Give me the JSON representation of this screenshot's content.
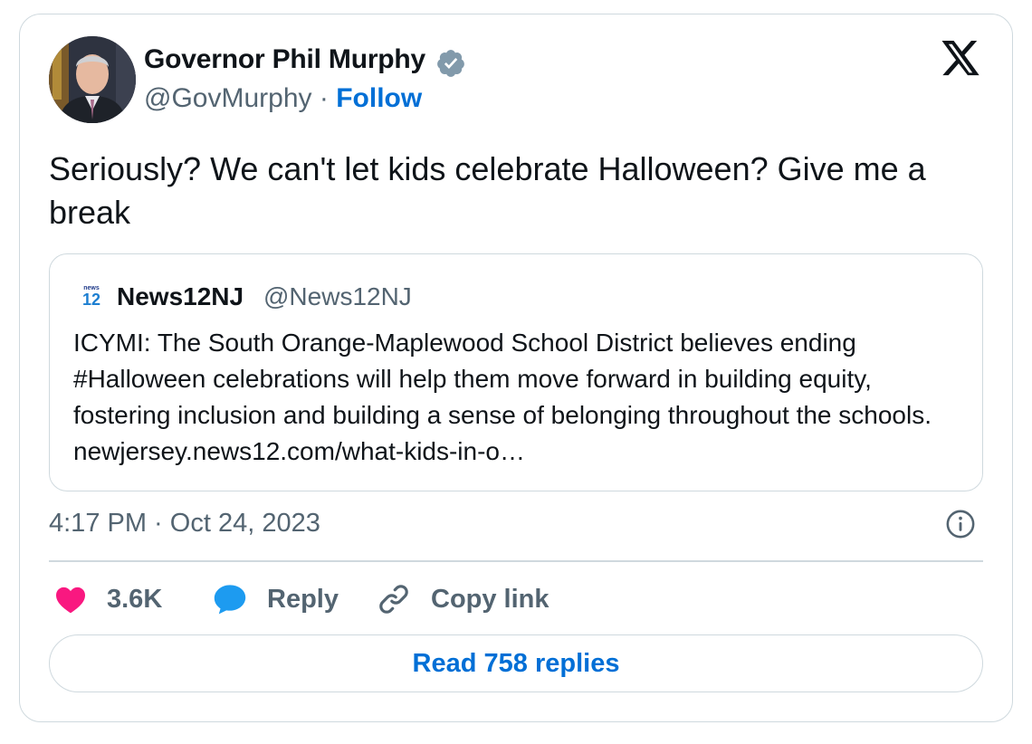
{
  "author": {
    "name": "Governor Phil Murphy",
    "handle": "@GovMurphy",
    "separator": "·",
    "follow_label": "Follow",
    "verified_color": "#829aab"
  },
  "tweet": {
    "text": "Seriously? We can't let kids celebrate Halloween? Give me a break",
    "timestamp": "4:17 PM · Oct 24, 2023"
  },
  "quoted_tweet": {
    "logo_text_top": "news",
    "logo_text_bottom": "12",
    "name": "News12NJ",
    "handle": "@News12NJ",
    "text": "ICYMI: The South Orange-Maplewood School District believes ending #Halloween celebrations will help them move forward in building equity, fostering inclusion and building a sense of belonging throughout the schools. newjersey.news12.com/what-kids-in-o…"
  },
  "actions": {
    "like_count": "3.6K",
    "reply_label": "Reply",
    "copy_label": "Copy link"
  },
  "read_replies_label": "Read 758 replies",
  "colors": {
    "link_blue": "#006fd6",
    "heart": "#f91880",
    "reply_bubble": "#1d9bf0",
    "secondary_text": "#536471",
    "border": "#cfd9de"
  },
  "icons": [
    "verified-badge-icon",
    "x-logo-icon",
    "info-icon",
    "heart-icon",
    "reply-bubble-icon",
    "link-icon",
    "news12-logo-icon"
  ]
}
